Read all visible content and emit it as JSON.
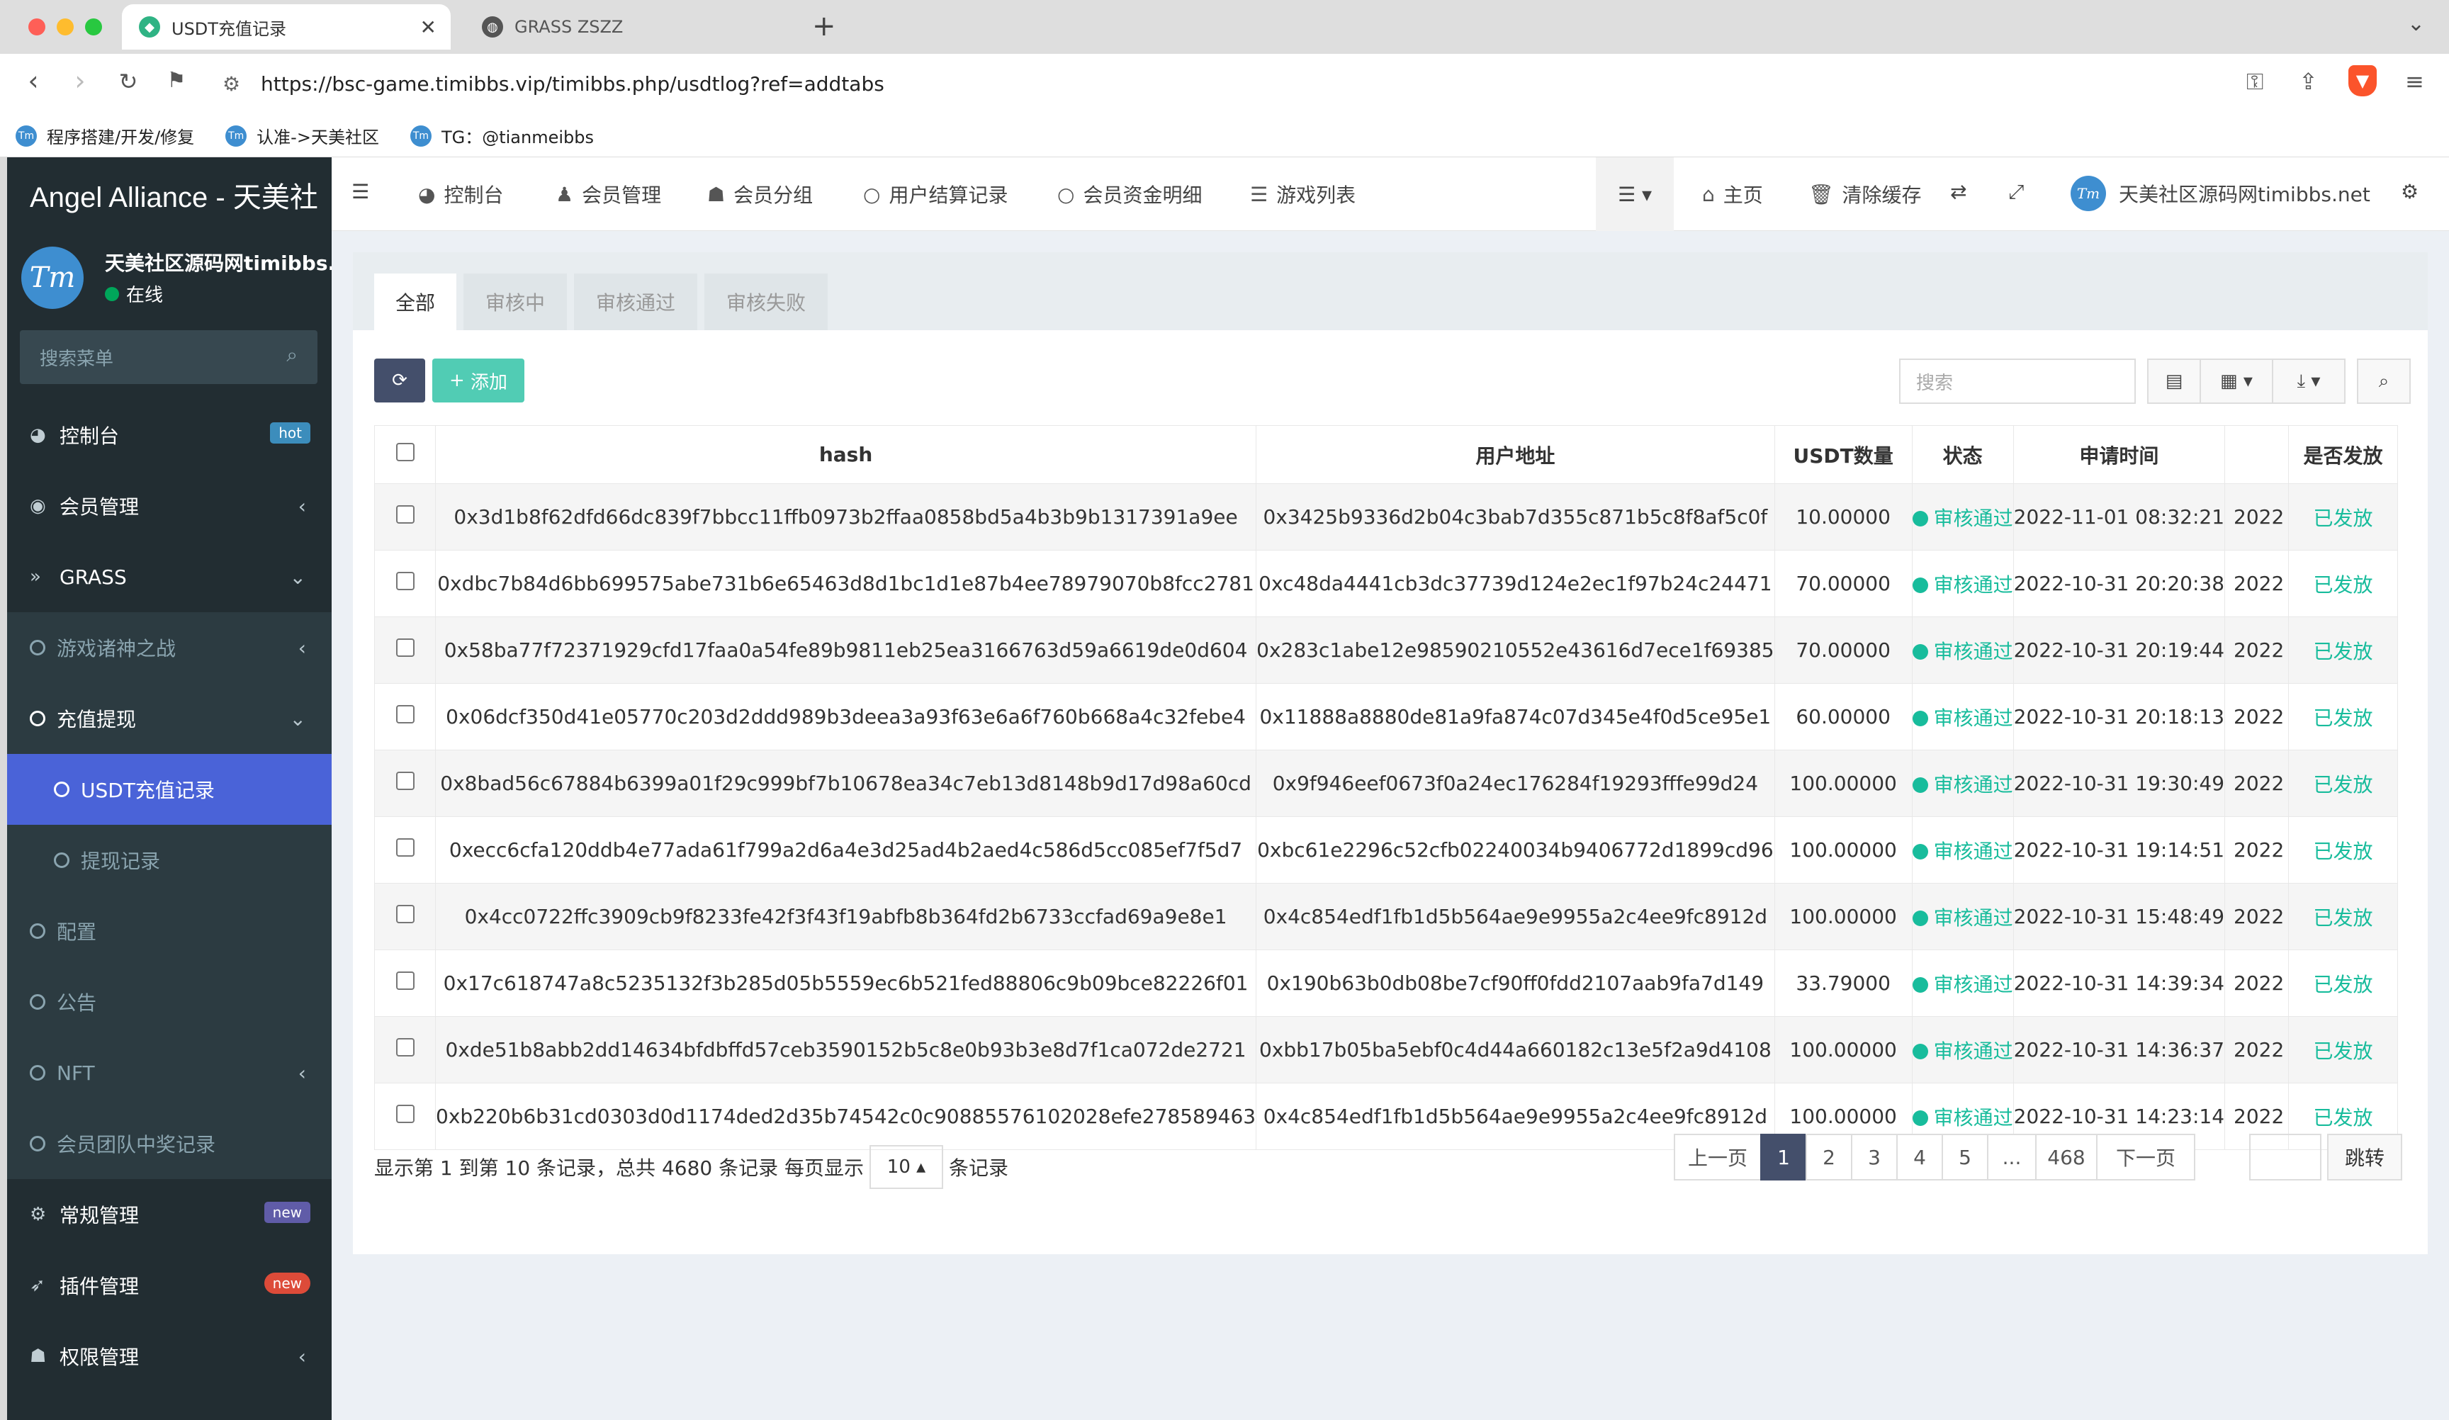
{
  "browser": {
    "tabs": [
      {
        "title": "USDT充值记录",
        "active": true
      },
      {
        "title": "GRASS ZSZZ",
        "active": false
      }
    ],
    "url": "https://bsc-game.timibbs.vip/timibbs.php/usdtlog?ref=addtabs",
    "bookmarks": [
      "程序搭建/开发/修复",
      "认准->天美社区",
      "TG：@tianmeibbs"
    ]
  },
  "sidebar": {
    "brand": "Angel Alliance - 天美社",
    "avatar_text": "Tm",
    "user_name": "天美社区源码网timibbs.net",
    "user_status": "在线",
    "search_placeholder": "搜索菜单",
    "items": [
      {
        "label": "控制台",
        "icon": "dashboard-icon",
        "badge": "hot"
      },
      {
        "label": "会员管理",
        "icon": "user-circle-icon",
        "arrow": "‹"
      },
      {
        "label": "GRASS",
        "icon": "double-chevron-icon",
        "arrow": "⌄"
      },
      {
        "label": "游戏诸神之战",
        "arrow": "‹"
      },
      {
        "label": "充值提现",
        "arrow": "⌄"
      },
      {
        "label": "USDT充值记录"
      },
      {
        "label": "提现记录"
      },
      {
        "label": "配置"
      },
      {
        "label": "公告"
      },
      {
        "label": "NFT",
        "arrow": "‹"
      },
      {
        "label": "会员团队中奖记录"
      },
      {
        "label": "常规管理",
        "icon": "gears-icon",
        "badge": "new"
      },
      {
        "label": "插件管理",
        "icon": "rocket-icon",
        "badge": "new"
      },
      {
        "label": "权限管理",
        "icon": "users-icon",
        "arrow": "‹"
      }
    ]
  },
  "topnav": {
    "items": [
      "控制台",
      "会员管理",
      "会员分组",
      "用户结算记录",
      "会员资金明细",
      "游戏列表"
    ],
    "home": "主页",
    "clear_cache": "清除缓存",
    "user": "天美社区源码网timibbs.net"
  },
  "tabs": [
    "全部",
    "审核中",
    "审核通过",
    "审核失败"
  ],
  "toolbar": {
    "add_label": "添加",
    "search_placeholder": "搜索"
  },
  "table": {
    "headers": [
      "hash",
      "用户地址",
      "USDT数量",
      "状态",
      "申请时间",
      "",
      "是否发放"
    ],
    "rows": [
      {
        "hash": "0x3d1b8f62dfd66dc839f7bbcc11ffb0973b2ffaa0858bd5a4b3b9b1317391a9ee",
        "address": "0x3425b9336d2b04c3bab7d355c871b5c8f8af5c0f",
        "amount": "10.00000",
        "status": "审核通过",
        "time": "2022-11-01 08:32:21",
        "extra": "2022",
        "issued": "已发放"
      },
      {
        "hash": "0xdbc7b84d6bb699575abe731b6e65463d8d1bc1d1e87b4ee78979070b8fcc2781",
        "address": "0xc48da4441cb3dc37739d124e2ec1f97b24c24471",
        "amount": "70.00000",
        "status": "审核通过",
        "time": "2022-10-31 20:20:38",
        "extra": "2022",
        "issued": "已发放"
      },
      {
        "hash": "0x58ba77f72371929cfd17faa0a54fe89b9811eb25ea3166763d59a6619de0d604",
        "address": "0x283c1abe12e98590210552e43616d7ece1f69385",
        "amount": "70.00000",
        "status": "审核通过",
        "time": "2022-10-31 20:19:44",
        "extra": "2022",
        "issued": "已发放"
      },
      {
        "hash": "0x06dcf350d41e05770c203d2ddd989b3deea3a93f63e6a6f760b668a4c32febe4",
        "address": "0x11888a8880de81a9fa874c07d345e4f0d5ce95e1",
        "amount": "60.00000",
        "status": "审核通过",
        "time": "2022-10-31 20:18:13",
        "extra": "2022",
        "issued": "已发放"
      },
      {
        "hash": "0x8bad56c67884b6399a01f29c999bf7b10678ea34c7eb13d8148b9d17d98a60cd",
        "address": "0x9f946eef0673f0a24ec176284f19293fffe99d24",
        "amount": "100.00000",
        "status": "审核通过",
        "time": "2022-10-31 19:30:49",
        "extra": "2022",
        "issued": "已发放"
      },
      {
        "hash": "0xecc6cfa120ddb4e77ada61f799a2d6a4e3d25ad4b2aed4c586d5cc085ef7f5d7",
        "address": "0xbc61e2296c52cfb02240034b9406772d1899cd96",
        "amount": "100.00000",
        "status": "审核通过",
        "time": "2022-10-31 19:14:51",
        "extra": "2022",
        "issued": "已发放"
      },
      {
        "hash": "0x4cc0722ffc3909cb9f8233fe42f3f43f19abfb8b364fd2b6733ccfad69a9e8e1",
        "address": "0x4c854edf1fb1d5b564ae9e9955a2c4ee9fc8912d",
        "amount": "100.00000",
        "status": "审核通过",
        "time": "2022-10-31 15:48:49",
        "extra": "2022",
        "issued": "已发放"
      },
      {
        "hash": "0x17c618747a8c5235132f3b285d05b5559ec6b521fed88806c9b09bce82226f01",
        "address": "0x190b63b0db08be7cf90ff0fdd2107aab9fa7d149",
        "amount": "33.79000",
        "status": "审核通过",
        "time": "2022-10-31 14:39:34",
        "extra": "2022",
        "issued": "已发放"
      },
      {
        "hash": "0xde51b8abb2dd14634bfdbffd57ceb3590152b5c8e0b93b3e8d7f1ca072de2721",
        "address": "0xbb17b05ba5ebf0c4d44a660182c13e5f2a9d4108",
        "amount": "100.00000",
        "status": "审核通过",
        "time": "2022-10-31 14:36:37",
        "extra": "2022",
        "issued": "已发放"
      },
      {
        "hash": "0xb220b6b31cd0303d0d1174ded2d35b74542c0c90885576102028efe278589463",
        "address": "0x4c854edf1fb1d5b564ae9e9955a2c4ee9fc8912d",
        "amount": "100.00000",
        "status": "审核通过",
        "time": "2022-10-31 14:23:14",
        "extra": "2022",
        "issued": "已发放"
      }
    ]
  },
  "pagination": {
    "info_prefix": "显示第 1 到第 10 条记录，总共 4680 条记录 每页显示",
    "page_size": "10",
    "info_suffix": "条记录",
    "prev": "上一页",
    "pages": [
      "1",
      "2",
      "3",
      "4",
      "5",
      "...",
      "468"
    ],
    "next": "下一页",
    "jump": "跳转"
  },
  "colors": {
    "sidebar": "#222d32",
    "active_menu": "#4a63d8",
    "success": "#18bc9c",
    "primary_dark": "#444f6b"
  }
}
